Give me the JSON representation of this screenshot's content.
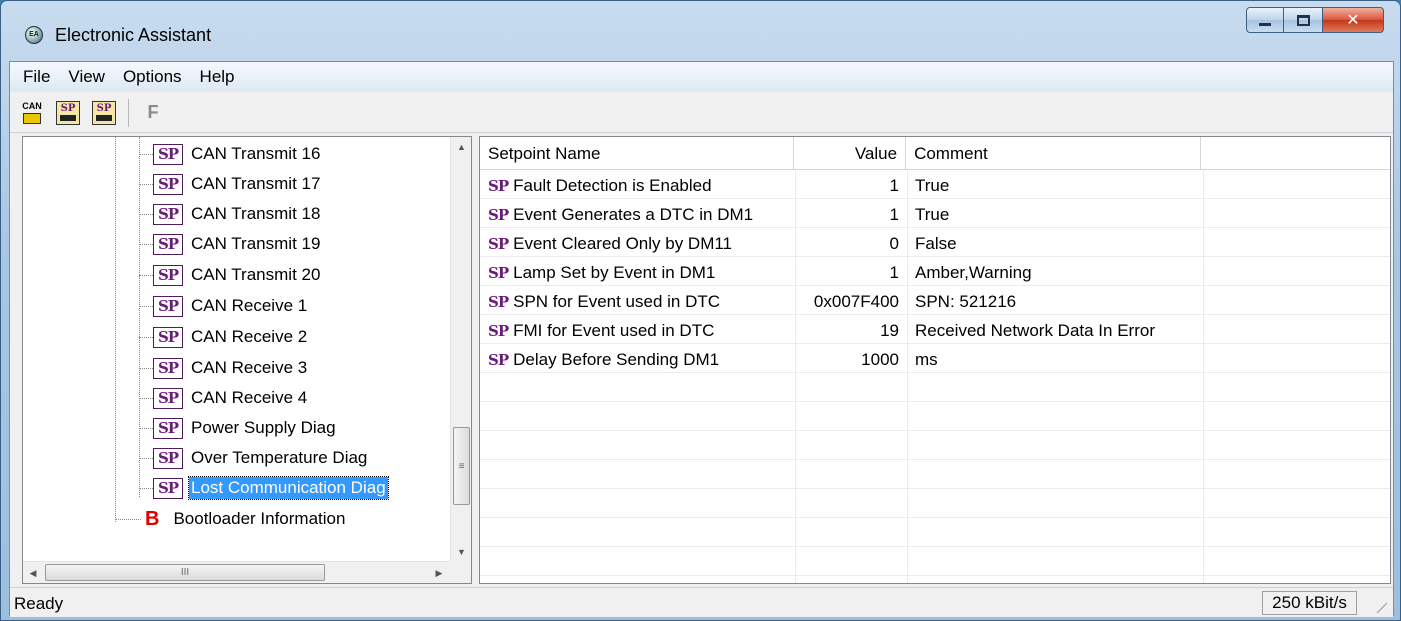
{
  "window": {
    "title": "Electronic Assistant",
    "icon": "app-logo-icon",
    "controls": [
      "minimize",
      "maximize",
      "close"
    ]
  },
  "menubar": {
    "items": [
      "File",
      "View",
      "Options",
      "Help"
    ]
  },
  "toolbar": {
    "buttons": [
      {
        "name": "can-connect",
        "icon": "can-network-icon",
        "label": "CAN"
      },
      {
        "name": "sp-open",
        "icon": "setpoint-open-icon",
        "label": "SP"
      },
      {
        "name": "sp-save",
        "icon": "setpoint-save-icon",
        "label": "SP"
      },
      {
        "name": "flash",
        "icon": "flash-f-icon",
        "label": "F"
      }
    ]
  },
  "tree": {
    "icon_text": "SP",
    "items": [
      {
        "label": "CAN Transmit 16"
      },
      {
        "label": "CAN Transmit 17"
      },
      {
        "label": "CAN Transmit 18"
      },
      {
        "label": "CAN Transmit 19"
      },
      {
        "label": "CAN Transmit 20"
      },
      {
        "label": "CAN Receive 1"
      },
      {
        "label": "CAN Receive 2"
      },
      {
        "label": "CAN Receive 3"
      },
      {
        "label": "CAN Receive 4"
      },
      {
        "label": "Power Supply Diag"
      },
      {
        "label": "Over Temperature Diag"
      },
      {
        "label": "Lost Communication Diag",
        "selected": true
      }
    ],
    "bootloader": {
      "icon_text": "B",
      "label": "Bootloader Information"
    },
    "scroll_glyph": "≡",
    "hscroll_glyph": "III"
  },
  "list": {
    "columns": [
      "Setpoint Name",
      "Value",
      "Comment"
    ],
    "icon_text": "SP",
    "rows": [
      {
        "name": "Fault Detection is Enabled",
        "value": "1",
        "comment": "True"
      },
      {
        "name": "Event Generates a DTC in DM1",
        "value": "1",
        "comment": "True"
      },
      {
        "name": "Event Cleared Only by DM11",
        "value": "0",
        "comment": "False"
      },
      {
        "name": "Lamp Set by Event in DM1",
        "value": "1",
        "comment": "Amber,Warning"
      },
      {
        "name": "SPN for Event used in DTC",
        "value": "0x007F400",
        "comment": "SPN: 521216"
      },
      {
        "name": "FMI for Event used in DTC",
        "value": "19",
        "comment": "Received Network Data In Error"
      },
      {
        "name": "Delay Before Sending DM1",
        "value": "1000",
        "comment": "ms"
      }
    ]
  },
  "statusbar": {
    "text": "Ready",
    "rate": "250 kBit/s"
  },
  "colors": {
    "selection": "#3399ff",
    "sp_icon": "#6a1b7a",
    "bootloader_icon": "#e00000",
    "title_gradient": "#a9c6e4"
  }
}
